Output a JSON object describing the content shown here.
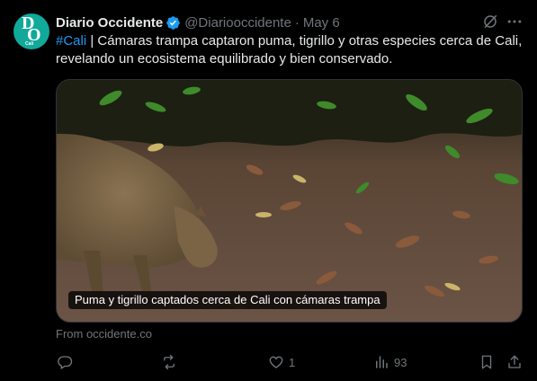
{
  "author": {
    "name": "Diario Occidente",
    "handle": "@Diariooccidente",
    "separator": "·",
    "date": "May 6",
    "avatar": {
      "letter_top": "D",
      "letter_bottom": "O",
      "city": "Cali",
      "color": "#11a99a"
    },
    "verified_icon": "verified-badge-icon"
  },
  "tweet": {
    "hashtag": "#Cali",
    "text": " | Cámaras trampa captaron puma, tigrillo y otras especies cerca de Cali, revelando un ecosistema equilibrado y bien conservado."
  },
  "media": {
    "caption": "Puma y tigrillo captados cerca de Cali con cámaras trampa",
    "source": "From occidente.co"
  },
  "actions": {
    "reply": {
      "icon": "reply-icon",
      "count": ""
    },
    "retweet": {
      "icon": "retweet-icon",
      "count": ""
    },
    "like": {
      "icon": "heart-icon",
      "count": "1"
    },
    "views": {
      "icon": "views-chart-icon",
      "count": "93"
    },
    "bookmark": {
      "icon": "bookmark-icon"
    },
    "share": {
      "icon": "share-icon"
    }
  },
  "colors": {
    "accent": "#1d9bf0",
    "muted": "#71767b",
    "text": "#e7e9ea",
    "background": "#000000"
  }
}
